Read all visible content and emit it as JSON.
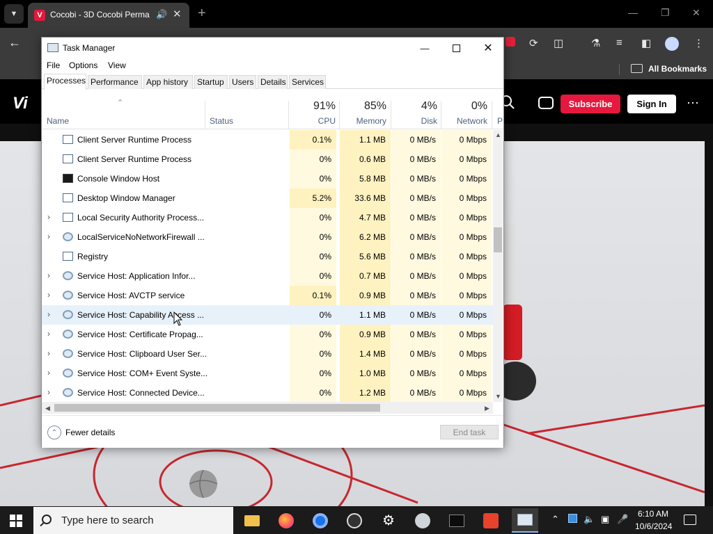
{
  "browser": {
    "tab_title": "Cocobi - 3D Cocobi Perma",
    "tab_favicon": "V",
    "new_tab": "+",
    "bookmarks_label": "All Bookmarks"
  },
  "website": {
    "logo": "Vi",
    "subscribe_label": "Subscribe",
    "signin_label": "Sign In",
    "more_label": "⋯",
    "accent_color": "#e6183d"
  },
  "task_manager": {
    "title": "Task Manager",
    "menu": [
      "File",
      "Options",
      "View"
    ],
    "tabs": [
      "Processes",
      "Performance",
      "App history",
      "Startup",
      "Users",
      "Details",
      "Services"
    ],
    "active_tab": "Processes",
    "columns": {
      "name": "Name",
      "status": "Status",
      "cpu": {
        "pct": "91%",
        "label": "CPU"
      },
      "memory": {
        "pct": "85%",
        "label": "Memory"
      },
      "disk": {
        "pct": "4%",
        "label": "Disk"
      },
      "network": {
        "pct": "0%",
        "label": "Network"
      },
      "partial": "P"
    },
    "processes": [
      {
        "name": "Client Server Runtime Process",
        "expand": "",
        "icon": "window-icon",
        "cpu": "0.1%",
        "memory": "1.1 MB",
        "disk": "0 MB/s",
        "network": "0 Mbps"
      },
      {
        "name": "Client Server Runtime Process",
        "expand": "",
        "icon": "window-icon",
        "cpu": "0%",
        "memory": "0.6 MB",
        "disk": "0 MB/s",
        "network": "0 Mbps"
      },
      {
        "name": "Console Window Host",
        "expand": "",
        "icon": "console-icon",
        "cpu": "0%",
        "memory": "5.8 MB",
        "disk": "0 MB/s",
        "network": "0 Mbps"
      },
      {
        "name": "Desktop Window Manager",
        "expand": "",
        "icon": "window-icon",
        "cpu": "5.2%",
        "memory": "33.6 MB",
        "disk": "0 MB/s",
        "network": "0 Mbps"
      },
      {
        "name": "Local Security Authority Process...",
        "expand": "›",
        "icon": "window-icon",
        "cpu": "0%",
        "memory": "4.7 MB",
        "disk": "0 MB/s",
        "network": "0 Mbps"
      },
      {
        "name": "LocalServiceNoNetworkFirewall ...",
        "expand": "›",
        "icon": "gear-icon",
        "cpu": "0%",
        "memory": "6.2 MB",
        "disk": "0 MB/s",
        "network": "0 Mbps"
      },
      {
        "name": "Registry",
        "expand": "",
        "icon": "window-icon",
        "cpu": "0%",
        "memory": "5.6 MB",
        "disk": "0 MB/s",
        "network": "0 Mbps"
      },
      {
        "name": "Service Host: Application Infor...",
        "expand": "›",
        "icon": "gear-icon",
        "cpu": "0%",
        "memory": "0.7 MB",
        "disk": "0 MB/s",
        "network": "0 Mbps"
      },
      {
        "name": "Service Host: AVCTP service",
        "expand": "›",
        "icon": "gear-icon",
        "cpu": "0.1%",
        "memory": "0.9 MB",
        "disk": "0 MB/s",
        "network": "0 Mbps"
      },
      {
        "name": "Service Host: Capability Access ...",
        "expand": "›",
        "icon": "gear-icon",
        "cpu": "0%",
        "memory": "1.1 MB",
        "disk": "0 MB/s",
        "network": "0 Mbps"
      },
      {
        "name": "Service Host: Certificate Propag...",
        "expand": "›",
        "icon": "gear-icon",
        "cpu": "0%",
        "memory": "0.9 MB",
        "disk": "0 MB/s",
        "network": "0 Mbps"
      },
      {
        "name": "Service Host: Clipboard User Ser...",
        "expand": "›",
        "icon": "gear-icon",
        "cpu": "0%",
        "memory": "1.4 MB",
        "disk": "0 MB/s",
        "network": "0 Mbps"
      },
      {
        "name": "Service Host: COM+ Event Syste...",
        "expand": "›",
        "icon": "gear-icon",
        "cpu": "0%",
        "memory": "1.0 MB",
        "disk": "0 MB/s",
        "network": "0 Mbps"
      },
      {
        "name": "Service Host: Connected Device...",
        "expand": "›",
        "icon": "gear-icon",
        "cpu": "0%",
        "memory": "1.2 MB",
        "disk": "0 MB/s",
        "network": "0 Mbps"
      }
    ],
    "hovered_row": 9,
    "fewer_details_label": "Fewer details",
    "end_task_label": "End task",
    "heat_colors": {
      "low": "#fff9e0",
      "mid": "#fff2c1"
    }
  },
  "taskbar": {
    "search_placeholder": "Type here to search",
    "time": "6:10 AM",
    "date": "10/6/2024",
    "apps": [
      "file-explorer-icon",
      "firefox-icon",
      "chrome-icon",
      "obs-icon",
      "settings-icon",
      "browser-icon",
      "terminal-icon",
      "remote-desktop-icon",
      "task-manager-icon"
    ]
  }
}
